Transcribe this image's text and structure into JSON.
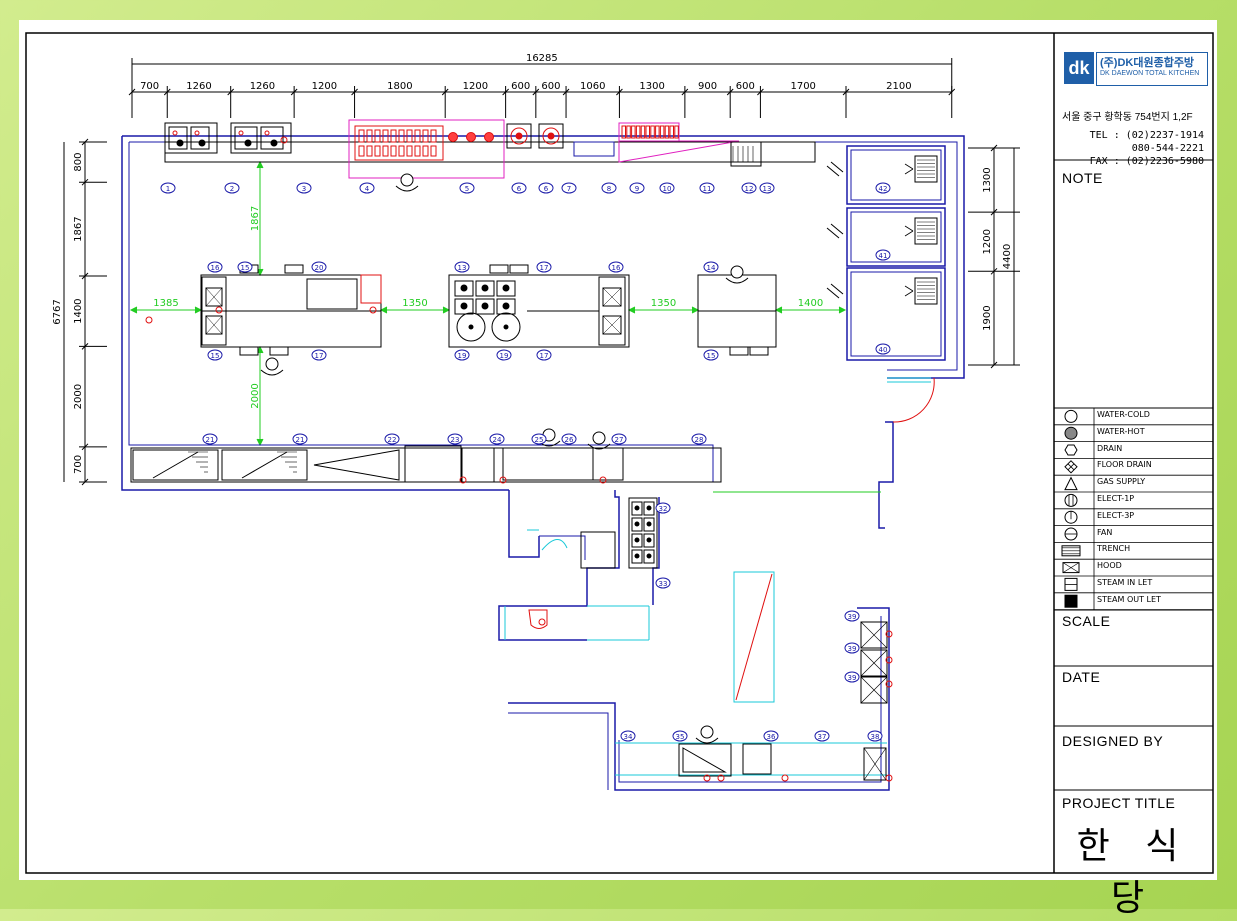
{
  "drawing": {
    "overall_dimension": "16285",
    "top_dimensions": [
      "700",
      "1260",
      "1260",
      "1200",
      "1800",
      "1200",
      "600",
      "600",
      "1060",
      "1300",
      "900",
      "600",
      "1700",
      "2100"
    ],
    "left_total": "6767",
    "left_dimensions": [
      "800",
      "1867",
      "1400",
      "2000",
      "700"
    ],
    "right_total": "4400",
    "right_dimensions": [
      "1300",
      "1200",
      "1900"
    ],
    "inner_dimensions": {
      "v_top": "1867",
      "v_bottom": "2000",
      "h1": "1385",
      "h2": "1350",
      "h3": "1350",
      "h4": "1400"
    },
    "top_row_tags": [
      "1",
      "2",
      "3",
      "4",
      "5",
      "6",
      "6",
      "7",
      "8",
      "9",
      "10",
      "11",
      "12",
      "13"
    ],
    "island_tags": [
      "16",
      "15",
      "20",
      "15",
      "17",
      "13",
      "17",
      "16",
      "19",
      "19",
      "17",
      "14",
      "15"
    ],
    "cold_room_tags": [
      "42",
      "41",
      "40"
    ],
    "bottom_row_tags": [
      "21",
      "21",
      "22",
      "23",
      "24",
      "25",
      "26",
      "27",
      "28"
    ],
    "lower_tags": [
      "32",
      "33",
      "39",
      "39",
      "39",
      "34",
      "35",
      "36",
      "37",
      "38"
    ]
  },
  "title_block": {
    "company_name": "(주)DK대원종합주방",
    "company_sub": "DK DAEWON TOTAL KITCHEN",
    "logo_mark": "dk",
    "address": "서울 중구 황학동 754번지 1,2F",
    "tel": "TEL : (02)2237-1914",
    "tel2": "080-544-2221",
    "fax": "FAX : (02)2236-5980",
    "note_label": "NOTE",
    "scale_label": "SCALE",
    "date_label": "DATE",
    "designed_by_label": "DESIGNED BY",
    "project_title_label": "PROJECT TITLE",
    "project_name": "한 식 당"
  },
  "legend": [
    {
      "icon": "water-cold-icon",
      "label": "WATER-COLD"
    },
    {
      "icon": "water-hot-icon",
      "label": "WATER-HOT"
    },
    {
      "icon": "drain-icon",
      "label": "DRAIN"
    },
    {
      "icon": "floor-drain-icon",
      "label": "FLOOR DRAIN"
    },
    {
      "icon": "gas-supply-icon",
      "label": "GAS SUPPLY"
    },
    {
      "icon": "elect-1p-icon",
      "label": "ELECT-1P"
    },
    {
      "icon": "elect-3p-icon",
      "label": "ELECT-3P"
    },
    {
      "icon": "fan-icon",
      "label": "FAN"
    },
    {
      "icon": "trench-icon",
      "label": "TRENCH"
    },
    {
      "icon": "hood-icon",
      "label": "HOOD"
    },
    {
      "icon": "steam-inlet-icon",
      "label": "STEAM IN LET"
    },
    {
      "icon": "steam-outlet-icon",
      "label": "STEAM OUT LET"
    }
  ],
  "colors": {
    "wall": "#1a1aa8",
    "dimension": "#000000",
    "inner_dimension": "#22cc22",
    "fixture_red": "#e01010",
    "cyan": "#18c8d8",
    "magenta": "#e020c0",
    "tag": "#1a1aa8"
  }
}
